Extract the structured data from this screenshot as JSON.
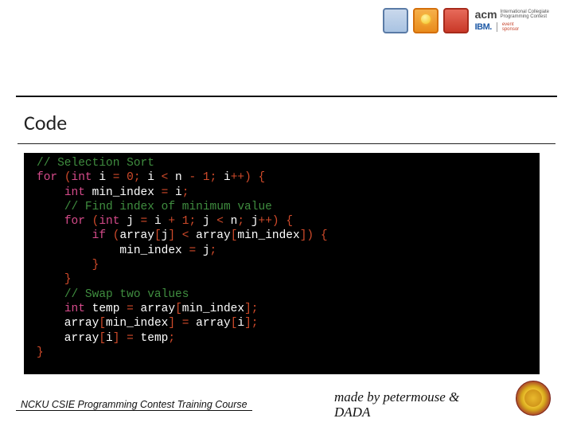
{
  "header": {
    "logo_squares": [
      "blue",
      "orange",
      "red"
    ],
    "acm_label": "acm",
    "acm_subtitle": "International Collegiate\nProgramming Contest",
    "ibm_label": "IBM.",
    "sponsor_label": "event\nsponsor"
  },
  "section": {
    "title": "Code"
  },
  "code": {
    "lines": [
      [
        {
          "t": "com",
          "s": "// Selection Sort"
        }
      ],
      [
        {
          "t": "kw",
          "s": "for"
        },
        {
          "t": "id",
          "s": " "
        },
        {
          "t": "op",
          "s": "("
        },
        {
          "t": "type",
          "s": "int"
        },
        {
          "t": "id",
          "s": " i "
        },
        {
          "t": "op",
          "s": "="
        },
        {
          "t": "id",
          "s": " "
        },
        {
          "t": "num",
          "s": "0"
        },
        {
          "t": "op",
          "s": ";"
        },
        {
          "t": "id",
          "s": " i "
        },
        {
          "t": "op",
          "s": "<"
        },
        {
          "t": "id",
          "s": " n "
        },
        {
          "t": "op",
          "s": "-"
        },
        {
          "t": "id",
          "s": " "
        },
        {
          "t": "num",
          "s": "1"
        },
        {
          "t": "op",
          "s": ";"
        },
        {
          "t": "id",
          "s": " i"
        },
        {
          "t": "op",
          "s": "++)"
        },
        {
          "t": "id",
          "s": " "
        },
        {
          "t": "op",
          "s": "{"
        }
      ],
      [
        {
          "t": "id",
          "s": "    "
        },
        {
          "t": "type",
          "s": "int"
        },
        {
          "t": "id",
          "s": " min_index "
        },
        {
          "t": "op",
          "s": "="
        },
        {
          "t": "id",
          "s": " i"
        },
        {
          "t": "op",
          "s": ";"
        }
      ],
      [
        {
          "t": "id",
          "s": "    "
        },
        {
          "t": "com",
          "s": "// Find index of minimum value"
        }
      ],
      [
        {
          "t": "id",
          "s": "    "
        },
        {
          "t": "kw",
          "s": "for"
        },
        {
          "t": "id",
          "s": " "
        },
        {
          "t": "op",
          "s": "("
        },
        {
          "t": "type",
          "s": "int"
        },
        {
          "t": "id",
          "s": " j "
        },
        {
          "t": "op",
          "s": "="
        },
        {
          "t": "id",
          "s": " i "
        },
        {
          "t": "op",
          "s": "+"
        },
        {
          "t": "id",
          "s": " "
        },
        {
          "t": "num",
          "s": "1"
        },
        {
          "t": "op",
          "s": ";"
        },
        {
          "t": "id",
          "s": " j "
        },
        {
          "t": "op",
          "s": "<"
        },
        {
          "t": "id",
          "s": " n"
        },
        {
          "t": "op",
          "s": ";"
        },
        {
          "t": "id",
          "s": " j"
        },
        {
          "t": "op",
          "s": "++)"
        },
        {
          "t": "id",
          "s": " "
        },
        {
          "t": "op",
          "s": "{"
        }
      ],
      [
        {
          "t": "id",
          "s": "        "
        },
        {
          "t": "kw",
          "s": "if"
        },
        {
          "t": "id",
          "s": " "
        },
        {
          "t": "op",
          "s": "("
        },
        {
          "t": "id",
          "s": "array"
        },
        {
          "t": "op",
          "s": "["
        },
        {
          "t": "id",
          "s": "j"
        },
        {
          "t": "op",
          "s": "]"
        },
        {
          "t": "id",
          "s": " "
        },
        {
          "t": "op",
          "s": "<"
        },
        {
          "t": "id",
          "s": " array"
        },
        {
          "t": "op",
          "s": "["
        },
        {
          "t": "id",
          "s": "min_index"
        },
        {
          "t": "op",
          "s": "])"
        },
        {
          "t": "id",
          "s": " "
        },
        {
          "t": "op",
          "s": "{"
        }
      ],
      [
        {
          "t": "id",
          "s": "            min_index "
        },
        {
          "t": "op",
          "s": "="
        },
        {
          "t": "id",
          "s": " j"
        },
        {
          "t": "op",
          "s": ";"
        }
      ],
      [
        {
          "t": "id",
          "s": "        "
        },
        {
          "t": "op",
          "s": "}"
        }
      ],
      [
        {
          "t": "id",
          "s": "    "
        },
        {
          "t": "op",
          "s": "}"
        }
      ],
      [
        {
          "t": "id",
          "s": "    "
        },
        {
          "t": "com",
          "s": "// Swap two values"
        }
      ],
      [
        {
          "t": "id",
          "s": "    "
        },
        {
          "t": "type",
          "s": "int"
        },
        {
          "t": "id",
          "s": " temp "
        },
        {
          "t": "op",
          "s": "="
        },
        {
          "t": "id",
          "s": " array"
        },
        {
          "t": "op",
          "s": "["
        },
        {
          "t": "id",
          "s": "min_index"
        },
        {
          "t": "op",
          "s": "];"
        }
      ],
      [
        {
          "t": "id",
          "s": "    array"
        },
        {
          "t": "op",
          "s": "["
        },
        {
          "t": "id",
          "s": "min_index"
        },
        {
          "t": "op",
          "s": "]"
        },
        {
          "t": "id",
          "s": " "
        },
        {
          "t": "op",
          "s": "="
        },
        {
          "t": "id",
          "s": " array"
        },
        {
          "t": "op",
          "s": "["
        },
        {
          "t": "id",
          "s": "i"
        },
        {
          "t": "op",
          "s": "];"
        }
      ],
      [
        {
          "t": "id",
          "s": "    array"
        },
        {
          "t": "op",
          "s": "["
        },
        {
          "t": "id",
          "s": "i"
        },
        {
          "t": "op",
          "s": "]"
        },
        {
          "t": "id",
          "s": " "
        },
        {
          "t": "op",
          "s": "="
        },
        {
          "t": "id",
          "s": " temp"
        },
        {
          "t": "op",
          "s": ";"
        }
      ],
      [
        {
          "t": "op",
          "s": "}"
        }
      ]
    ]
  },
  "footer": {
    "left": "NCKU CSIE Programming Contest Training Course",
    "right_line1": "made by petermouse &",
    "right_line2": "DADA"
  }
}
